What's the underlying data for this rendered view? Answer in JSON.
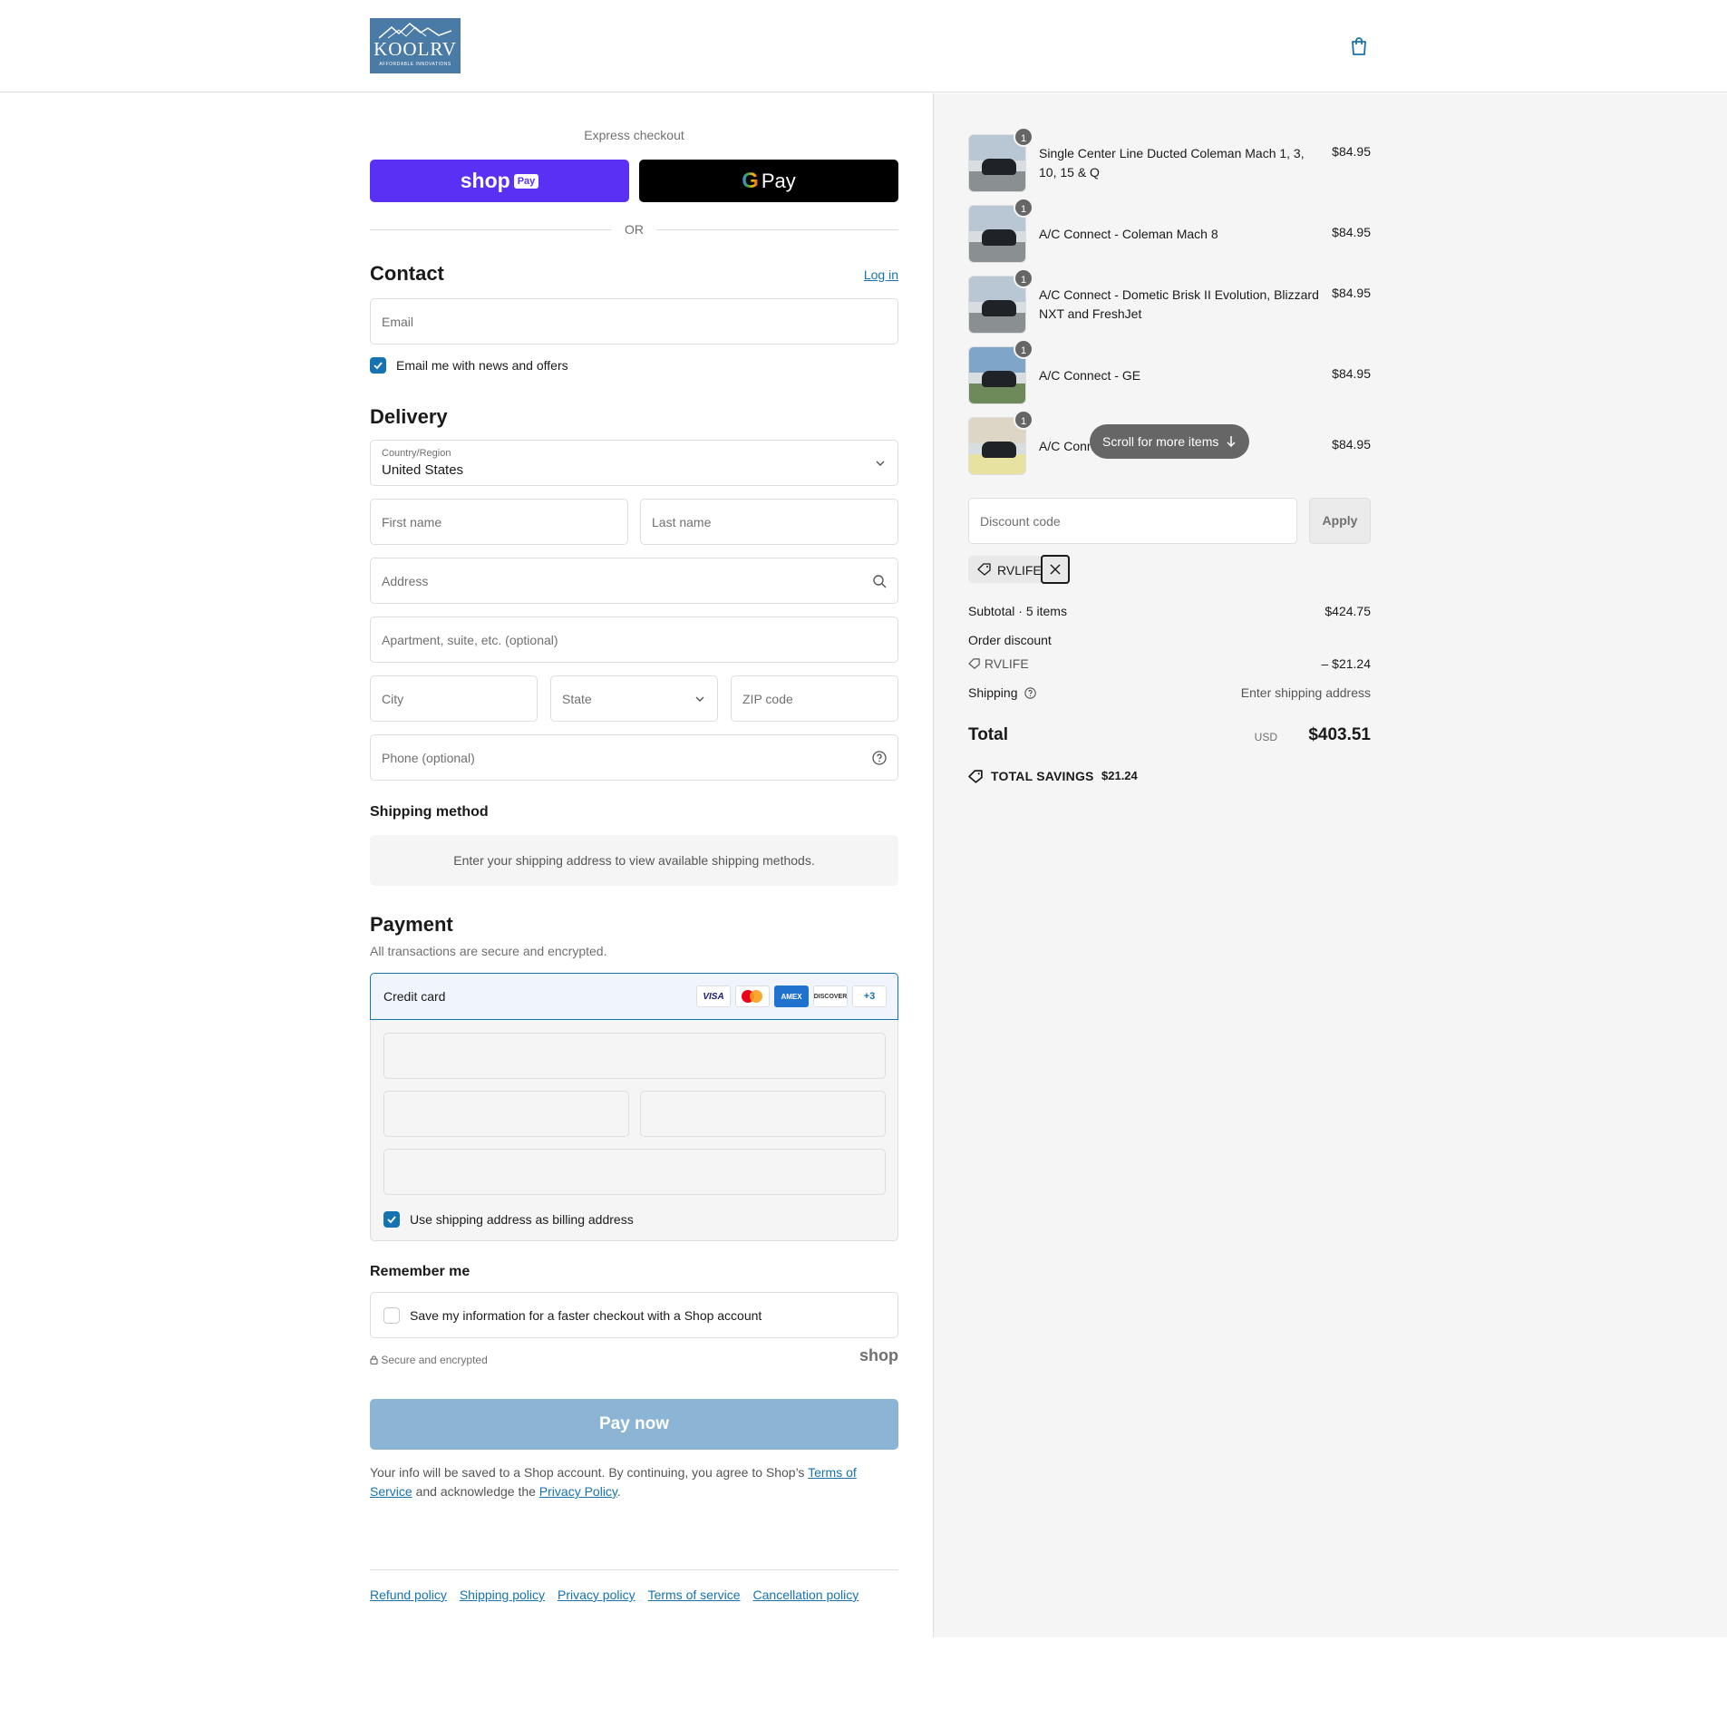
{
  "header": {
    "logo_text": "KOOLRV",
    "logo_tagline": "AFFORDABLE INNOVATIONS"
  },
  "express": {
    "label": "Express checkout",
    "shop_pay_label": "shop",
    "shop_pay_badge": "Pay",
    "gpay_g": "G",
    "gpay_label": "Pay",
    "or_label": "OR"
  },
  "contact": {
    "title": "Contact",
    "login_label": "Log in",
    "email_placeholder": "Email",
    "news_label": "Email me with news and offers",
    "news_checked": true
  },
  "delivery": {
    "title": "Delivery",
    "country_label": "Country/Region",
    "country_value": "United States",
    "first_name_placeholder": "First name",
    "last_name_placeholder": "Last name",
    "address_placeholder": "Address",
    "apartment_placeholder": "Apartment, suite, etc. (optional)",
    "city_placeholder": "City",
    "state_placeholder": "State",
    "zip_placeholder": "ZIP code",
    "phone_placeholder": "Phone (optional)"
  },
  "shipping_method": {
    "title": "Shipping method",
    "info": "Enter your shipping address to view available shipping methods."
  },
  "payment": {
    "title": "Payment",
    "subtitle": "All transactions are secure and encrypted.",
    "credit_card_label": "Credit card",
    "card_brands": [
      "VISA",
      "Mastercard",
      "AMEX",
      "DISCOVER",
      "+3"
    ],
    "billing_label": "Use shipping address as billing address",
    "billing_checked": true
  },
  "remember": {
    "title": "Remember me",
    "save_label": "Save my information for a faster checkout with a Shop account",
    "save_checked": false
  },
  "secure_label": "Secure and encrypted",
  "shop_mark": "shop",
  "pay_now_label": "Pay now",
  "legal": {
    "text_before": "Your info will be saved to a Shop account. By continuing, you agree to Shop’s ",
    "terms_link": "Terms of Service",
    "text_middle": " and acknowledge the ",
    "privacy_link": "Privacy Policy",
    "text_after": "."
  },
  "footer_links": [
    "Refund policy",
    "Shipping policy",
    "Privacy policy",
    "Terms of service",
    "Cancellation policy"
  ],
  "summary": {
    "items": [
      {
        "qty": "1",
        "name": "Single Center Line Ducted Coleman Mach 1, 3, 10, 15 & Q",
        "price": "$84.95"
      },
      {
        "qty": "1",
        "name": "A/C Connect - Coleman Mach 8",
        "price": "$84.95"
      },
      {
        "qty": "1",
        "name": "A/C Connect - Dometic Brisk II Evolution, Blizzard NXT and FreshJet",
        "price": "$84.95"
      },
      {
        "qty": "1",
        "name": "A/C Connect - GE",
        "price": "$84.95"
      },
      {
        "qty": "1",
        "name": "A/C Conn",
        "price": "$84.95"
      }
    ],
    "scroll_hint": "Scroll for more items",
    "discount_placeholder": "Discount code",
    "apply_label": "Apply",
    "applied_code": "RVLIFE",
    "subtotal_label": "Subtotal · 5 items",
    "subtotal_value": "$424.75",
    "order_discount_label": "Order discount",
    "discount_code": "RVLIFE",
    "discount_value": "– $21.24",
    "shipping_label": "Shipping",
    "shipping_value": "Enter shipping address",
    "total_label": "Total",
    "total_currency": "USD",
    "total_value": "$403.51",
    "savings_label": "TOTAL SAVINGS",
    "savings_value": "$21.24"
  },
  "colors": {
    "accent": "#1773b0",
    "shop_pay": "#5a31f4",
    "pay_now_disabled": "#8bb4d5"
  }
}
